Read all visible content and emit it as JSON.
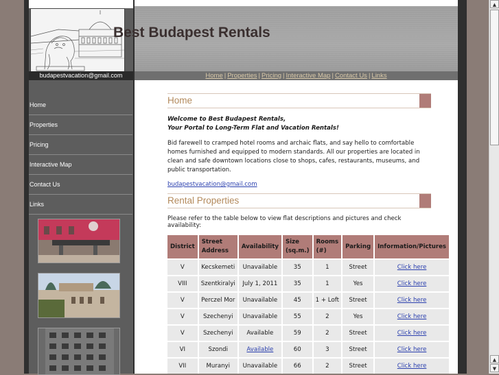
{
  "site": {
    "title": "Best Budapest Rentals",
    "email": "budapestvacation@gmail.com"
  },
  "topnav": {
    "items": [
      "Home",
      "Properties",
      "Pricing",
      "Interactive Map",
      "Contact Us",
      "Links"
    ],
    "separator": "|"
  },
  "sidebar": {
    "items": [
      "Home",
      "Properties",
      "Pricing",
      "Interactive Map",
      "Contact Us",
      "Links"
    ]
  },
  "home": {
    "heading": "Home",
    "welcome_line1": "Welcome to Best Budapest Rentals,",
    "welcome_line2": "Your Portal to Long-Term Flat and Vacation Rentals!",
    "body": "Bid farewell to cramped hotel rooms and archaic flats, and say hello to comfortable homes furnished and equipped to modern standards. All our properties are located in clean and safe downtown locations close to shops, cafes, restaurants, museums, and public transportation.",
    "email_link": "budapestvacation@gmail.com"
  },
  "rentals": {
    "heading": "Rental Properties",
    "intro": "Please refer to the table below to view flat descriptions and pictures and check availability:",
    "columns": [
      "District",
      "Street Address",
      "Availability",
      "Size (sq.m.)",
      "Rooms (#)",
      "Parking",
      "Information/Pictures"
    ],
    "rows": [
      {
        "district": "V",
        "street": "Kecskemeti",
        "availability": "Unavailable",
        "size": "35",
        "rooms": "1",
        "parking": "Street",
        "info": "Click here"
      },
      {
        "district": "VIII",
        "street": "Szentkiralyi",
        "availability": "July 1, 2011",
        "size": "35",
        "rooms": "1",
        "parking": "Yes",
        "info": "Click here"
      },
      {
        "district": "V",
        "street": "Perczel Mor",
        "availability": "Unavailable",
        "size": "45",
        "rooms": "1 + Loft",
        "parking": "Street",
        "info": "Click here"
      },
      {
        "district": "V",
        "street": "Szechenyi",
        "availability": "Unavailable",
        "size": "55",
        "rooms": "2",
        "parking": "Yes",
        "info": "Click here"
      },
      {
        "district": "V",
        "street": "Szechenyi",
        "availability": "Available",
        "size": "59",
        "rooms": "2",
        "parking": "Street",
        "info": "Click here"
      },
      {
        "district": "VI",
        "street": "Szondi",
        "availability": "Available",
        "size": "60",
        "rooms": "3",
        "parking": "Street",
        "info": "Click here"
      },
      {
        "district": "VII",
        "street": "Muranyi",
        "availability": "Unavailable",
        "size": "66",
        "rooms": "2",
        "parking": "Street",
        "info": "Click here"
      }
    ]
  },
  "colors": {
    "accent": "#b07c78",
    "heading_text": "#b38a5c",
    "unavailable": "#e02020",
    "available": "#2a2ab0",
    "link": "#2a3fae"
  }
}
